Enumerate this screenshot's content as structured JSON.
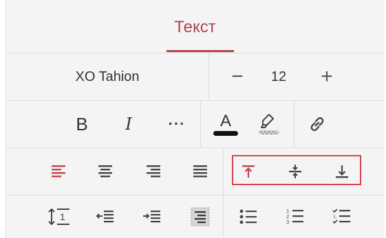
{
  "header": {
    "tab_label": "Текст"
  },
  "font": {
    "name": "XO Tahion",
    "size": "12",
    "decrease_label": "−",
    "increase_label": "+"
  },
  "style": {
    "bold_label": "B",
    "italic_label": "I",
    "more_label": "···",
    "font_color_letter": "A"
  },
  "paragraph": {
    "line_spacing_value": "1"
  },
  "colors": {
    "accent": "#b5414b",
    "highlight_box": "#d9434f",
    "font_color_bar": "#111111"
  },
  "icons": [
    "font-color-icon",
    "highlighter-icon",
    "link-icon",
    "align-left-icon",
    "align-center-icon",
    "align-right-icon",
    "align-justify-icon",
    "valign-top-icon",
    "valign-middle-icon",
    "valign-bottom-icon",
    "line-spacing-icon",
    "decrease-indent-icon",
    "increase-indent-icon",
    "paragraph-background-icon",
    "bullet-list-icon",
    "numbered-list-icon",
    "checklist-icon"
  ]
}
